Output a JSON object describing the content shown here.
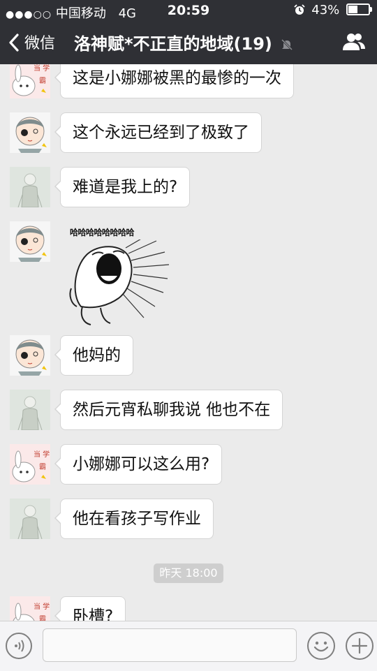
{
  "status_bar": {
    "signal_dots": "●●●○○",
    "carrier": "中国移动",
    "network": "4G",
    "time": "20:59",
    "alarm_icon": "alarm-clock-icon",
    "battery_percent": "43%",
    "battery_level": 0.43
  },
  "nav": {
    "back_label": "微信",
    "title": "洛神赋*不正直的地域(19)",
    "mute_icon": "bell-off-icon",
    "contacts_icon": "group-icon"
  },
  "messages": [
    {
      "avatar": "rabbit-avatar",
      "text": "这是小娜娜被黑的最惨的一次"
    },
    {
      "avatar": "cartoon-boy-avatar",
      "text": "这个永远已经到了极致了"
    },
    {
      "avatar": "pale-figure-avatar",
      "text": "难道是我上的?"
    },
    {
      "avatar": "cartoon-boy-avatar",
      "sticker_caption": "哈哈哈哈哈哈哈哈"
    },
    {
      "avatar": "cartoon-boy-avatar",
      "text": "他妈的"
    },
    {
      "avatar": "pale-figure-avatar",
      "text": "然后元宵私聊我说 他也不在"
    },
    {
      "avatar": "rabbit-avatar",
      "text": "小娜娜可以这么用?"
    },
    {
      "avatar": "pale-figure-avatar",
      "text": "他在看孩子写作业"
    },
    {
      "avatar": "rabbit-avatar",
      "text": "卧槽?"
    }
  ],
  "timestamp": "昨天 18:00",
  "input_bar": {
    "voice_icon": "voice-icon",
    "text_value": "",
    "emoji_icon": "smiley-icon",
    "plus_icon": "plus-icon"
  }
}
